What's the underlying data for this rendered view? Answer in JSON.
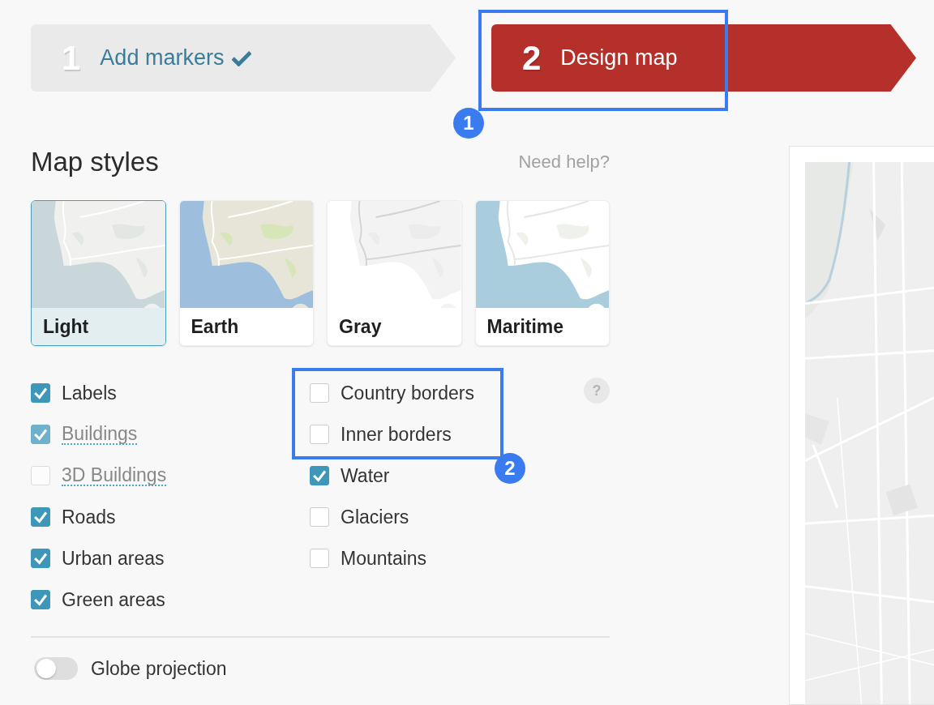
{
  "steps": [
    {
      "number": "1",
      "label": "Add markers",
      "done": true,
      "selected": false
    },
    {
      "number": "2",
      "label": "Design map",
      "done": false,
      "selected": true
    }
  ],
  "heading": "Map styles",
  "help_link": "Need help?",
  "styles": [
    {
      "label": "Light",
      "selected": true
    },
    {
      "label": "Earth",
      "selected": false
    },
    {
      "label": "Gray",
      "selected": false
    },
    {
      "label": "Maritime",
      "selected": false
    }
  ],
  "layers_left": [
    {
      "label": "Labels",
      "checked": true,
      "disabled": false
    },
    {
      "label": "Buildings",
      "checked": true,
      "disabled": true
    },
    {
      "label": "3D Buildings",
      "checked": false,
      "disabled": true
    },
    {
      "label": "Roads",
      "checked": true,
      "disabled": false
    },
    {
      "label": "Urban areas",
      "checked": true,
      "disabled": false
    },
    {
      "label": "Green areas",
      "checked": true,
      "disabled": false
    }
  ],
  "layers_right": [
    {
      "label": "Country borders",
      "checked": false,
      "disabled": false
    },
    {
      "label": "Inner borders",
      "checked": false,
      "disabled": false
    },
    {
      "label": "Water",
      "checked": true,
      "disabled": false
    },
    {
      "label": "Glaciers",
      "checked": false,
      "disabled": false
    },
    {
      "label": "Mountains",
      "checked": false,
      "disabled": false
    }
  ],
  "help_icon": "?",
  "globe_projection": {
    "label": "Globe projection",
    "on": false
  },
  "annotations": [
    {
      "number": "1"
    },
    {
      "number": "2"
    }
  ]
}
